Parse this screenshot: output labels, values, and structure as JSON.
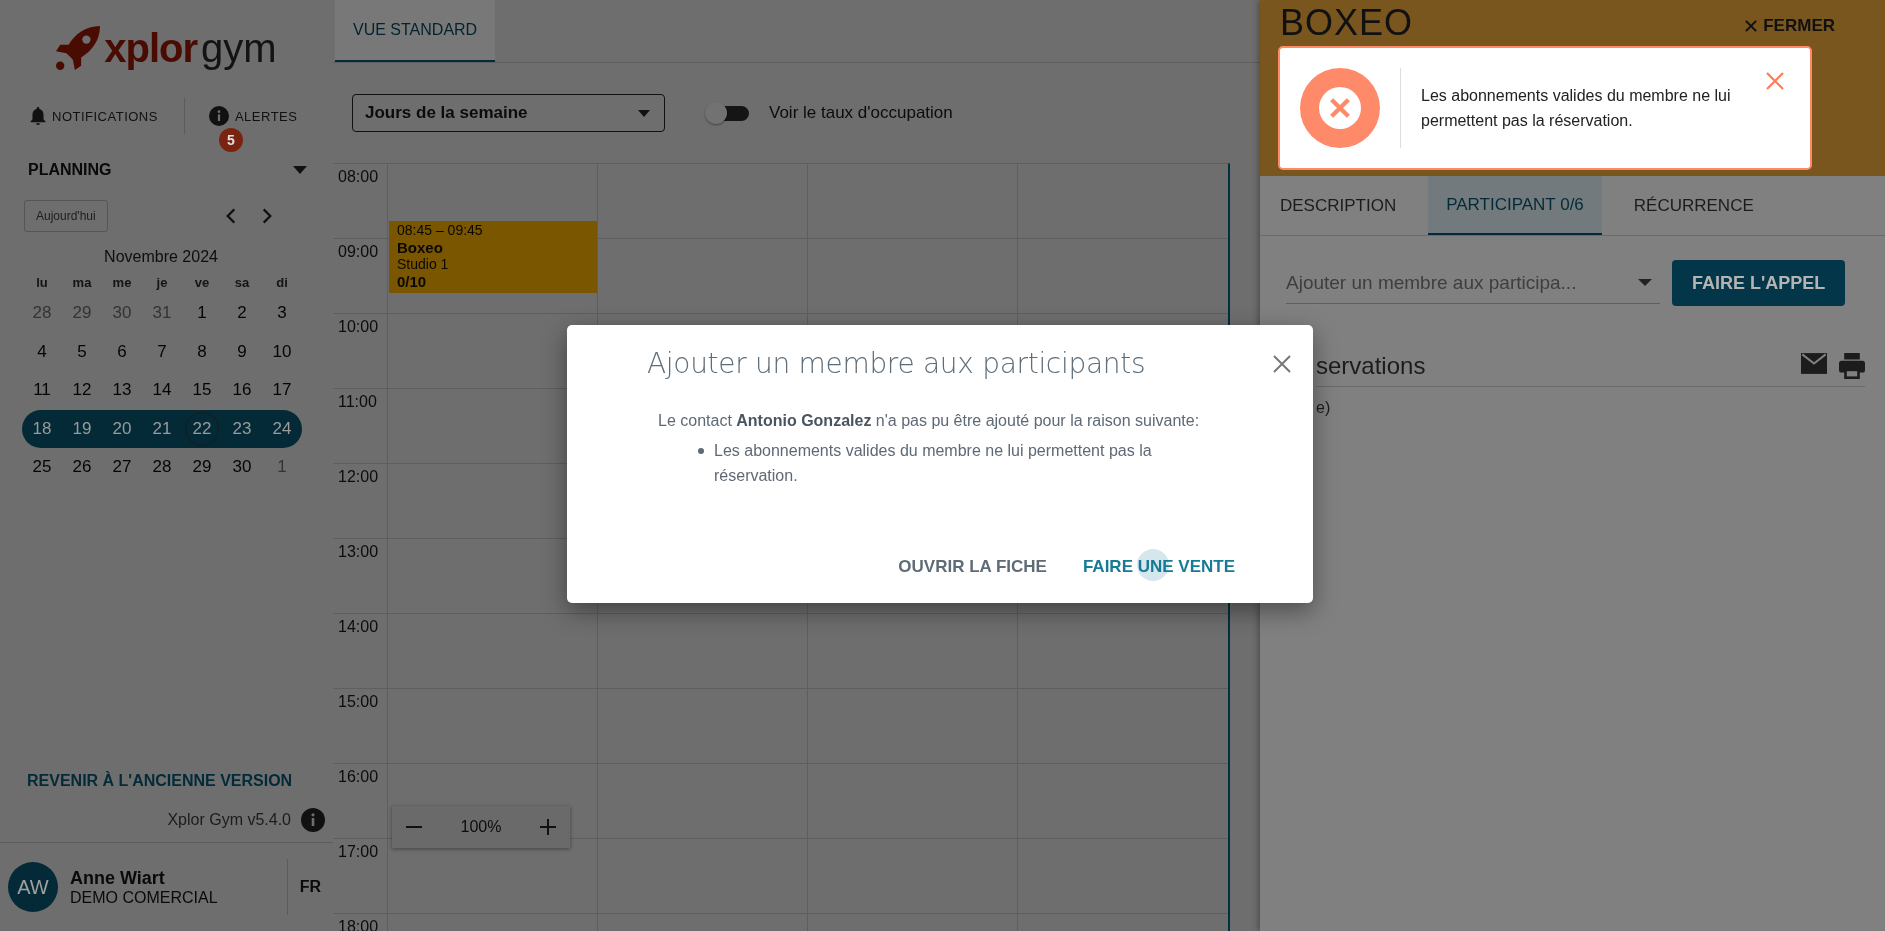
{
  "sidebar": {
    "logo": {
      "brand": "xplor",
      "product": "gym"
    },
    "notifications": {
      "label": "NOTIFICATIONS"
    },
    "alerts": {
      "label": "ALERTES",
      "badge": "5"
    },
    "section": {
      "title": "PLANNING",
      "expanded": true
    },
    "mini_calendar": {
      "today_button": "Aujourd'hui",
      "month": "Novembre 2024",
      "weekdays": [
        "lu",
        "ma",
        "me",
        "je",
        "ve",
        "sa",
        "di"
      ],
      "weeks": [
        {
          "selected": false,
          "days": [
            {
              "label": "28",
              "muted": true,
              "today": false
            },
            {
              "label": "29",
              "muted": true,
              "today": false
            },
            {
              "label": "30",
              "muted": true,
              "today": false
            },
            {
              "label": "31",
              "muted": true,
              "today": false
            },
            {
              "label": "1",
              "muted": false,
              "today": false
            },
            {
              "label": "2",
              "muted": false,
              "today": false
            },
            {
              "label": "3",
              "muted": false,
              "today": false
            }
          ]
        },
        {
          "selected": false,
          "days": [
            {
              "label": "4",
              "muted": false,
              "today": false
            },
            {
              "label": "5",
              "muted": false,
              "today": false
            },
            {
              "label": "6",
              "muted": false,
              "today": false
            },
            {
              "label": "7",
              "muted": false,
              "today": false
            },
            {
              "label": "8",
              "muted": false,
              "today": false
            },
            {
              "label": "9",
              "muted": false,
              "today": false
            },
            {
              "label": "10",
              "muted": false,
              "today": false
            }
          ]
        },
        {
          "selected": false,
          "days": [
            {
              "label": "11",
              "muted": false,
              "today": false
            },
            {
              "label": "12",
              "muted": false,
              "today": false
            },
            {
              "label": "13",
              "muted": false,
              "today": false
            },
            {
              "label": "14",
              "muted": false,
              "today": false
            },
            {
              "label": "15",
              "muted": false,
              "today": false
            },
            {
              "label": "16",
              "muted": false,
              "today": false
            },
            {
              "label": "17",
              "muted": false,
              "today": false
            }
          ]
        },
        {
          "selected": true,
          "days": [
            {
              "label": "18",
              "muted": false,
              "today": false
            },
            {
              "label": "19",
              "muted": false,
              "today": false
            },
            {
              "label": "20",
              "muted": false,
              "today": false
            },
            {
              "label": "21",
              "muted": false,
              "today": false
            },
            {
              "label": "22",
              "muted": false,
              "today": true
            },
            {
              "label": "23",
              "muted": false,
              "today": false
            },
            {
              "label": "24",
              "muted": false,
              "today": false
            }
          ]
        },
        {
          "selected": false,
          "days": [
            {
              "label": "25",
              "muted": false,
              "today": false
            },
            {
              "label": "26",
              "muted": false,
              "today": false
            },
            {
              "label": "27",
              "muted": false,
              "today": false
            },
            {
              "label": "28",
              "muted": false,
              "today": false
            },
            {
              "label": "29",
              "muted": false,
              "today": false
            },
            {
              "label": "30",
              "muted": false,
              "today": false
            },
            {
              "label": "1",
              "muted": true,
              "today": false
            }
          ]
        }
      ]
    },
    "legacy_link": "REVENIR À L'ANCIENNE VERSION",
    "version": "Xplor Gym v5.4.0",
    "user": {
      "initials": "AW",
      "name": "Anne Wiart",
      "company": "DEMO COMERCIAL",
      "language": "FR"
    }
  },
  "main": {
    "tabs": [
      {
        "label": "VUE STANDARD",
        "selected": true
      }
    ],
    "view_select": {
      "value": "Jours de la semaine"
    },
    "occupancy_toggle": {
      "label": "Voir le taux d'occupation",
      "on": false
    },
    "schedule": {
      "hours": [
        "08:00",
        "09:00",
        "10:00",
        "11:00",
        "12:00",
        "13:00",
        "14:00",
        "15:00",
        "16:00",
        "17:00",
        "18:00"
      ],
      "events": [
        {
          "time": "08:45 – 09:45",
          "title": "Boxeo",
          "room": "Studio 1",
          "count": "0/10",
          "color": "#7a5600"
        }
      ]
    },
    "zoom": {
      "value": "100%"
    }
  },
  "drawer": {
    "title": "BOXEO",
    "close": "FERMER",
    "tabs": [
      {
        "label": "DESCRIPTION",
        "selected": false
      },
      {
        "label": "PARTICIPANT 0/6",
        "selected": true
      },
      {
        "label": "RÉCURRENCE",
        "selected": false
      }
    ],
    "member_select": {
      "placeholder": "Ajouter un membre aux participa..."
    },
    "call_button": "FAIRE L'APPEL",
    "reservations": {
      "heading": "servations",
      "note": "e)"
    }
  },
  "toast": {
    "message": "Les abonnements valides du membre ne lui permettent pas la réservation."
  },
  "modal": {
    "title": "Ajouter un membre aux participants",
    "message": "Le contact **Antonio Gonzalez** n'a pas pu être ajouté pour la raison suivante:",
    "reasons": [
      "Les abonnements valides du membre ne lui permettent pas la réservation."
    ],
    "actions": [
      {
        "label": "OUVRIR LA FICHE",
        "kind": "secondary"
      },
      {
        "label": "FAIRE UNE VENTE",
        "kind": "primary"
      }
    ]
  }
}
